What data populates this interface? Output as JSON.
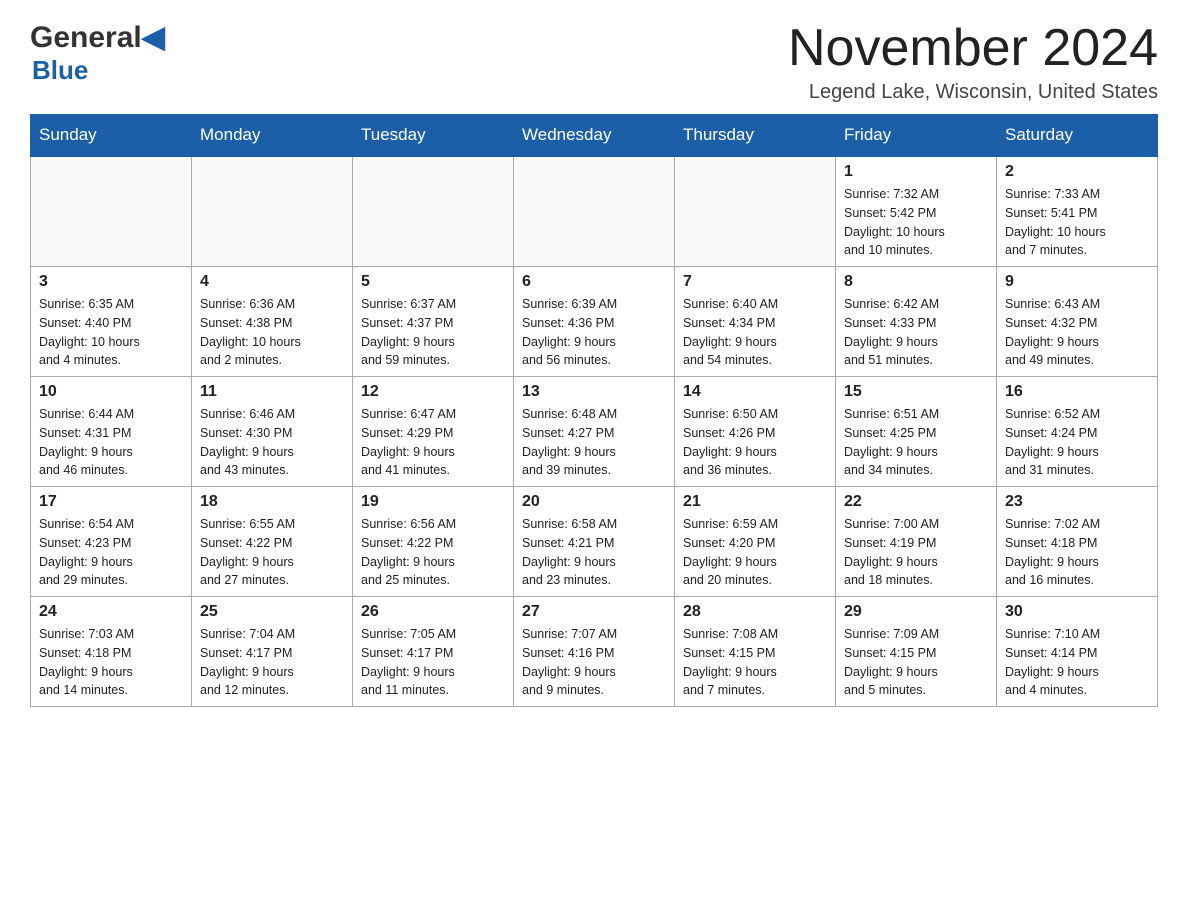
{
  "logo": {
    "general": "General",
    "blue": "Blue"
  },
  "title": "November 2024",
  "location": "Legend Lake, Wisconsin, United States",
  "days_of_week": [
    "Sunday",
    "Monday",
    "Tuesday",
    "Wednesday",
    "Thursday",
    "Friday",
    "Saturday"
  ],
  "weeks": [
    [
      {
        "day": "",
        "info": ""
      },
      {
        "day": "",
        "info": ""
      },
      {
        "day": "",
        "info": ""
      },
      {
        "day": "",
        "info": ""
      },
      {
        "day": "",
        "info": ""
      },
      {
        "day": "1",
        "info": "Sunrise: 7:32 AM\nSunset: 5:42 PM\nDaylight: 10 hours\nand 10 minutes."
      },
      {
        "day": "2",
        "info": "Sunrise: 7:33 AM\nSunset: 5:41 PM\nDaylight: 10 hours\nand 7 minutes."
      }
    ],
    [
      {
        "day": "3",
        "info": "Sunrise: 6:35 AM\nSunset: 4:40 PM\nDaylight: 10 hours\nand 4 minutes."
      },
      {
        "day": "4",
        "info": "Sunrise: 6:36 AM\nSunset: 4:38 PM\nDaylight: 10 hours\nand 2 minutes."
      },
      {
        "day": "5",
        "info": "Sunrise: 6:37 AM\nSunset: 4:37 PM\nDaylight: 9 hours\nand 59 minutes."
      },
      {
        "day": "6",
        "info": "Sunrise: 6:39 AM\nSunset: 4:36 PM\nDaylight: 9 hours\nand 56 minutes."
      },
      {
        "day": "7",
        "info": "Sunrise: 6:40 AM\nSunset: 4:34 PM\nDaylight: 9 hours\nand 54 minutes."
      },
      {
        "day": "8",
        "info": "Sunrise: 6:42 AM\nSunset: 4:33 PM\nDaylight: 9 hours\nand 51 minutes."
      },
      {
        "day": "9",
        "info": "Sunrise: 6:43 AM\nSunset: 4:32 PM\nDaylight: 9 hours\nand 49 minutes."
      }
    ],
    [
      {
        "day": "10",
        "info": "Sunrise: 6:44 AM\nSunset: 4:31 PM\nDaylight: 9 hours\nand 46 minutes."
      },
      {
        "day": "11",
        "info": "Sunrise: 6:46 AM\nSunset: 4:30 PM\nDaylight: 9 hours\nand 43 minutes."
      },
      {
        "day": "12",
        "info": "Sunrise: 6:47 AM\nSunset: 4:29 PM\nDaylight: 9 hours\nand 41 minutes."
      },
      {
        "day": "13",
        "info": "Sunrise: 6:48 AM\nSunset: 4:27 PM\nDaylight: 9 hours\nand 39 minutes."
      },
      {
        "day": "14",
        "info": "Sunrise: 6:50 AM\nSunset: 4:26 PM\nDaylight: 9 hours\nand 36 minutes."
      },
      {
        "day": "15",
        "info": "Sunrise: 6:51 AM\nSunset: 4:25 PM\nDaylight: 9 hours\nand 34 minutes."
      },
      {
        "day": "16",
        "info": "Sunrise: 6:52 AM\nSunset: 4:24 PM\nDaylight: 9 hours\nand 31 minutes."
      }
    ],
    [
      {
        "day": "17",
        "info": "Sunrise: 6:54 AM\nSunset: 4:23 PM\nDaylight: 9 hours\nand 29 minutes."
      },
      {
        "day": "18",
        "info": "Sunrise: 6:55 AM\nSunset: 4:22 PM\nDaylight: 9 hours\nand 27 minutes."
      },
      {
        "day": "19",
        "info": "Sunrise: 6:56 AM\nSunset: 4:22 PM\nDaylight: 9 hours\nand 25 minutes."
      },
      {
        "day": "20",
        "info": "Sunrise: 6:58 AM\nSunset: 4:21 PM\nDaylight: 9 hours\nand 23 minutes."
      },
      {
        "day": "21",
        "info": "Sunrise: 6:59 AM\nSunset: 4:20 PM\nDaylight: 9 hours\nand 20 minutes."
      },
      {
        "day": "22",
        "info": "Sunrise: 7:00 AM\nSunset: 4:19 PM\nDaylight: 9 hours\nand 18 minutes."
      },
      {
        "day": "23",
        "info": "Sunrise: 7:02 AM\nSunset: 4:18 PM\nDaylight: 9 hours\nand 16 minutes."
      }
    ],
    [
      {
        "day": "24",
        "info": "Sunrise: 7:03 AM\nSunset: 4:18 PM\nDaylight: 9 hours\nand 14 minutes."
      },
      {
        "day": "25",
        "info": "Sunrise: 7:04 AM\nSunset: 4:17 PM\nDaylight: 9 hours\nand 12 minutes."
      },
      {
        "day": "26",
        "info": "Sunrise: 7:05 AM\nSunset: 4:17 PM\nDaylight: 9 hours\nand 11 minutes."
      },
      {
        "day": "27",
        "info": "Sunrise: 7:07 AM\nSunset: 4:16 PM\nDaylight: 9 hours\nand 9 minutes."
      },
      {
        "day": "28",
        "info": "Sunrise: 7:08 AM\nSunset: 4:15 PM\nDaylight: 9 hours\nand 7 minutes."
      },
      {
        "day": "29",
        "info": "Sunrise: 7:09 AM\nSunset: 4:15 PM\nDaylight: 9 hours\nand 5 minutes."
      },
      {
        "day": "30",
        "info": "Sunrise: 7:10 AM\nSunset: 4:14 PM\nDaylight: 9 hours\nand 4 minutes."
      }
    ]
  ]
}
